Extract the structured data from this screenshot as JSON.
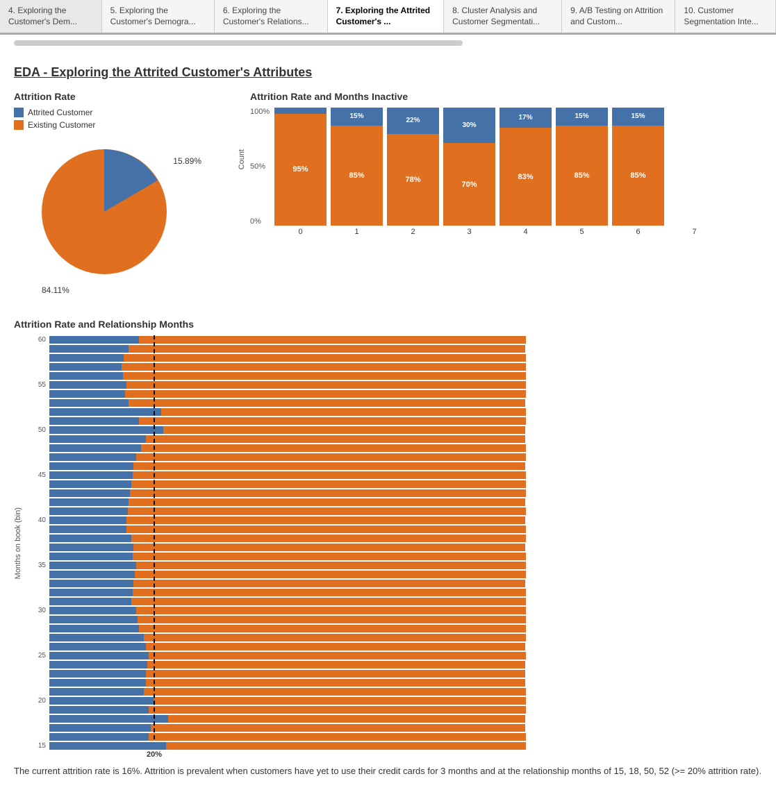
{
  "tabs": [
    {
      "id": "tab4",
      "label": "4. Exploring the Customer's Dem...",
      "active": false
    },
    {
      "id": "tab5",
      "label": "5. Exploring the Customer's Demogra...",
      "active": false
    },
    {
      "id": "tab6",
      "label": "6. Exploring the Customer's Relations...",
      "active": false
    },
    {
      "id": "tab7",
      "label": "7. Exploring the Attrited Customer's ...",
      "active": true
    },
    {
      "id": "tab8",
      "label": "8. Cluster Analysis and Customer Segmentati...",
      "active": false
    },
    {
      "id": "tab9",
      "label": "9. A/B Testing on Attrition and Custom...",
      "active": false
    },
    {
      "id": "tab10",
      "label": "10. Customer Segmentation Inte...",
      "active": false
    }
  ],
  "page_title": "EDA - Exploring the Attrited Customer's Attributes",
  "pie_chart": {
    "title": "Attrition Rate",
    "legend": [
      {
        "label": "Attrited Customer",
        "color": "#4472a8"
      },
      {
        "label": "Existing Customer",
        "color": "#e07020"
      }
    ],
    "attrited_pct": 15.89,
    "existing_pct": 84.11
  },
  "bar_chart": {
    "title": "Attrition Rate and Months Inactive",
    "y_label": "Count",
    "x_label_values": [
      "0",
      "1",
      "2",
      "3",
      "4",
      "5",
      "6",
      "7"
    ],
    "bars": [
      {
        "x": "0",
        "attrited": 5,
        "existing": 95
      },
      {
        "x": "1",
        "attrited": 15,
        "existing": 85
      },
      {
        "x": "2",
        "attrited": 22,
        "existing": 78
      },
      {
        "x": "3",
        "attrited": 30,
        "existing": 70
      },
      {
        "x": "4",
        "attrited": 17,
        "existing": 83
      },
      {
        "x": "5",
        "attrited": 15,
        "existing": 85
      },
      {
        "x": "6",
        "attrited": 15,
        "existing": 85
      }
    ]
  },
  "hbar_chart": {
    "title": "Attrition Rate and Relationship Months",
    "y_axis_title": "Months on book (bin)",
    "dashed_line_label": "20%",
    "dashed_line_position_pct": 22
  },
  "footnote": "The current attrition rate is 16%. Attrition is prevalent when customers have yet to use their credit cards for 3 months and at the relationship months of 15, 18, 50, 52 (>= 20% attrition rate)."
}
